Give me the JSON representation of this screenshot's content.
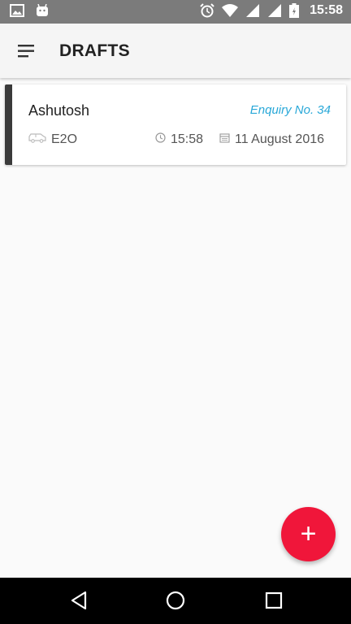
{
  "status_bar": {
    "time": "15:58",
    "icons": [
      "image-icon",
      "android-icon",
      "alarm-icon",
      "wifi-icon",
      "signal-icon",
      "battery-icon"
    ]
  },
  "app_bar": {
    "title": "DRAFTS",
    "menu_icon": "hamburger-menu-icon"
  },
  "drafts": [
    {
      "customer": "Ashutosh",
      "enquiry": "Enquiry No. 34",
      "route": "E2O",
      "time": "15:58",
      "date": "11 August 2016",
      "accent_color": "#3a3a3a"
    }
  ],
  "fab": {
    "label": "+",
    "color": "#f0163a"
  },
  "colors": {
    "enquiry_text": "#29a8d8",
    "status_bar": "#7b7b7b",
    "nav_bar": "#000000"
  },
  "nav_bar": {
    "icons": [
      "back-icon",
      "home-icon",
      "recents-icon"
    ]
  }
}
